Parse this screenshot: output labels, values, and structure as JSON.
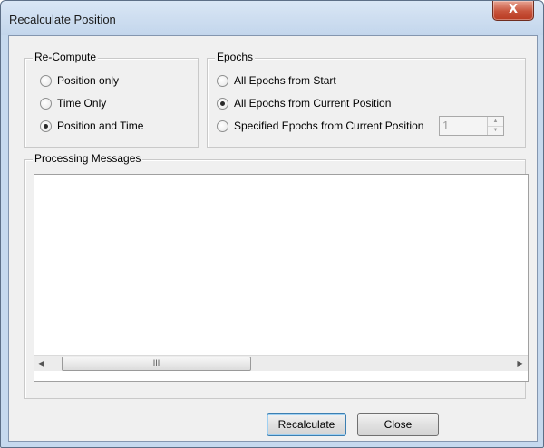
{
  "window": {
    "title": "Recalculate Position",
    "close_glyph": "X"
  },
  "recompute": {
    "legend": "Re-Compute",
    "options": [
      {
        "label": "Position only",
        "selected": false
      },
      {
        "label": "Time Only",
        "selected": false
      },
      {
        "label": "Position and Time",
        "selected": true
      }
    ]
  },
  "epochs": {
    "legend": "Epochs",
    "options": [
      {
        "label": "All Epochs from Start",
        "selected": false
      },
      {
        "label": "All Epochs from Current Position",
        "selected": true
      },
      {
        "label": "Specified Epochs from Current Position",
        "selected": false
      }
    ],
    "spinner_value": "1"
  },
  "messages": {
    "legend": "Processing Messages",
    "scroll_grip": "III"
  },
  "buttons": {
    "recalculate": "Recalculate",
    "close": "Close"
  }
}
